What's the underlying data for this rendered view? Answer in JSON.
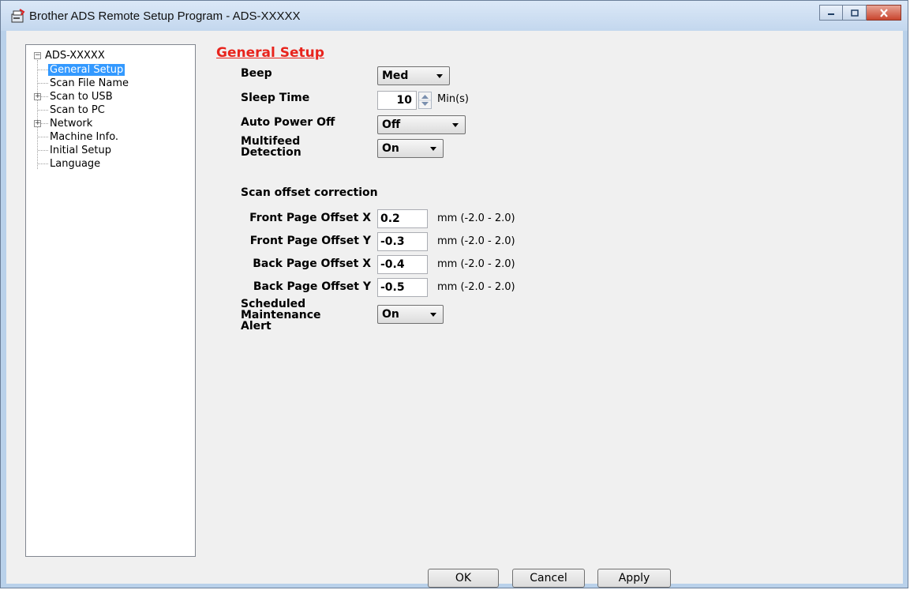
{
  "window": {
    "title": "Brother ADS Remote Setup Program - ADS-XXXXX"
  },
  "tree": {
    "root": "ADS-XXXXX",
    "items": [
      {
        "label": "General Setup",
        "selected": true,
        "expandable": false
      },
      {
        "label": "Scan File Name",
        "selected": false,
        "expandable": false
      },
      {
        "label": "Scan to USB",
        "selected": false,
        "expandable": true
      },
      {
        "label": "Scan to PC",
        "selected": false,
        "expandable": false
      },
      {
        "label": "Network",
        "selected": false,
        "expandable": true
      },
      {
        "label": "Machine Info.",
        "selected": false,
        "expandable": false
      },
      {
        "label": "Initial Setup",
        "selected": false,
        "expandable": false
      },
      {
        "label": "Language",
        "selected": false,
        "expandable": false
      }
    ]
  },
  "panel": {
    "title": "General Setup",
    "beep": {
      "label": "Beep",
      "value": "Med"
    },
    "sleep_time": {
      "label": "Sleep Time",
      "value": "10",
      "unit": "Min(s)"
    },
    "auto_power_off": {
      "label": "Auto Power Off",
      "value": "Off"
    },
    "multifeed": {
      "label_line1": "Multifeed",
      "label_line2": "Detection",
      "value": "On"
    },
    "scan_offset": {
      "heading": "Scan offset correction",
      "front_x": {
        "label": "Front Page Offset X",
        "value": "0.2",
        "range": "mm (-2.0 - 2.0)"
      },
      "front_y": {
        "label": "Front Page Offset Y",
        "value": "-0.3",
        "range": "mm (-2.0 - 2.0)"
      },
      "back_x": {
        "label": "Back Page Offset X",
        "value": "-0.4",
        "range": "mm (-2.0 - 2.0)"
      },
      "back_y": {
        "label": "Back Page Offset Y",
        "value": "-0.5",
        "range": "mm (-2.0 - 2.0)"
      }
    },
    "maintenance": {
      "label_line1": "Scheduled",
      "label_line2": "Maintenance",
      "label_line3": "Alert",
      "value": "On"
    }
  },
  "buttons": {
    "ok": "OK",
    "cancel": "Cancel",
    "apply": "Apply"
  },
  "colors": {
    "section_title": "#e8241d",
    "selection": "#3399ff",
    "close_button": "#c9452e"
  }
}
